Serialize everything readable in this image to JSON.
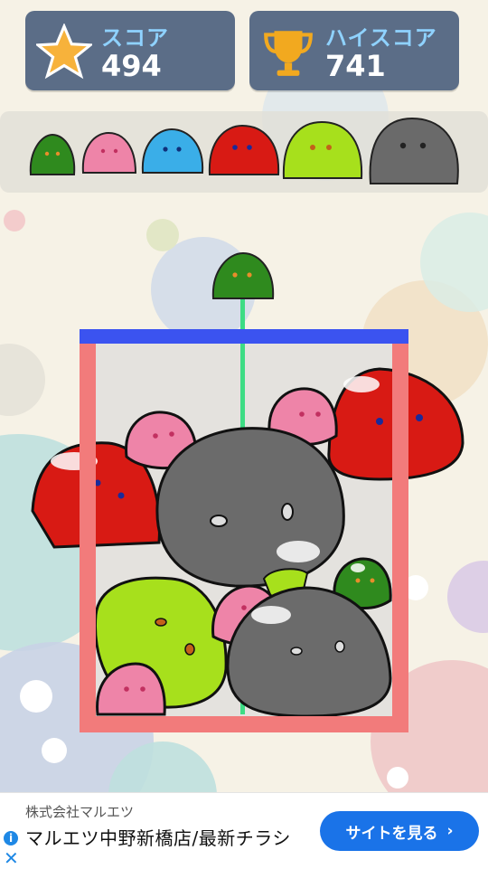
{
  "hud": {
    "score_label": "スコア",
    "score_value": "494",
    "highscore_label": "ハイスコア",
    "highscore_value": "741"
  },
  "evolution": [
    {
      "color": "green",
      "icon": "slime-green-icon"
    },
    {
      "color": "pink",
      "icon": "slime-pink-icon"
    },
    {
      "color": "blue",
      "icon": "slime-blue-icon"
    },
    {
      "color": "red",
      "icon": "slime-red-icon"
    },
    {
      "color": "lime",
      "icon": "slime-lime-icon"
    },
    {
      "color": "gray",
      "icon": "slime-gray-icon"
    }
  ],
  "colors": {
    "container_wall": "#f27b7b",
    "container_top": "#3b53f0",
    "drop_guide": "#3ddc84",
    "score_panel": "#5b6d87",
    "score_label": "#8fd2ff"
  },
  "ad": {
    "company": "株式会社マルエツ",
    "title": "マルエツ中野新橋店/最新チラシ",
    "cta": "サイトを見る",
    "info_icon": "i",
    "close_icon": "✕"
  }
}
